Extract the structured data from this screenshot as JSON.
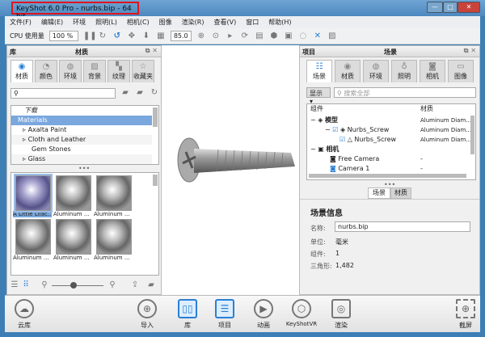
{
  "window": {
    "title": "KeyShot 6.0 Pro  - nurbs.bip  - 64 bit",
    "min": "—",
    "max": "□",
    "close": "✕"
  },
  "menu": [
    "文件(F)",
    "编辑(E)",
    "环境",
    "照明(L)",
    "相机(C)",
    "图像",
    "渲染(R)",
    "查看(V)",
    "窗口",
    "帮助(H)"
  ],
  "toolbar": {
    "cpu_label": "CPU 使用量",
    "cpu_value": "100 %",
    "fov_value": "85.0"
  },
  "library": {
    "title_left": "库",
    "title": "材质",
    "tabs": [
      "材质",
      "颜色",
      "环境",
      "背景",
      "纹理",
      "收藏夹"
    ],
    "tree": [
      {
        "label": "下载"
      },
      {
        "label": "Materials"
      },
      {
        "label": "Axalta Paint"
      },
      {
        "label": "Cloth and Leather"
      },
      {
        "label": "Gem Stones"
      },
      {
        "label": "Glass"
      }
    ],
    "thumbs": [
      "A Little Lilac...",
      "Aluminum ...",
      "Aluminum ...",
      "Aluminum ...",
      "Aluminum ...",
      "Aluminum ..."
    ],
    "zoom_value": 0.4
  },
  "project": {
    "title_left": "项目",
    "title": "场景",
    "tabs": [
      "场景",
      "材质",
      "环境",
      "照明",
      "相机",
      "图像"
    ],
    "show_label": "显示",
    "search_placeholder": "搜索全部",
    "columns": [
      "组件",
      "材质"
    ],
    "rows": [
      {
        "name": "模型",
        "mat": "Aluminum Diam..."
      },
      {
        "name": "Nurbs_Screw",
        "mat": "Aluminum Diam..."
      },
      {
        "name": "Nurbs_Screw",
        "mat": "Aluminum Diam..."
      },
      {
        "name": "相机",
        "mat": ""
      },
      {
        "name": "Free Camera",
        "mat": "-"
      },
      {
        "name": "Camera 1",
        "mat": "-"
      }
    ],
    "subtabs": [
      "场景",
      "材质"
    ],
    "info": {
      "heading": "场景信息",
      "name_label": "名称:",
      "name_value": "nurbs.bip",
      "unit_label": "单位:",
      "unit_value": "毫米",
      "parts_label": "组件:",
      "parts_value": "1",
      "tri_label": "三角形:",
      "tri_value": "1,482"
    }
  },
  "bottom": [
    "云库",
    "导入",
    "库",
    "项目",
    "动画",
    "KeyShotVR",
    "渲染",
    "截屏"
  ]
}
